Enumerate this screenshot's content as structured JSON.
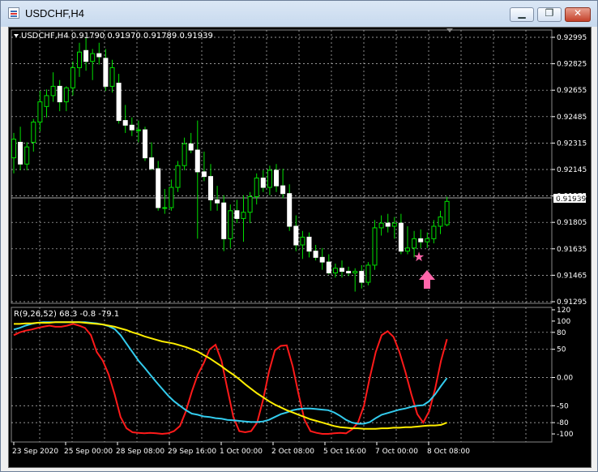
{
  "window": {
    "title": "USDCHF,H4",
    "minimize_glyph": "▁",
    "restore_glyph": "❐",
    "close_glyph": "✕"
  },
  "price_panel": {
    "header": "USDCHF,H4  0.91790 0.91970 0.91789 0.91939",
    "current_price": "0.91939",
    "price_ticks": [
      "0.92995",
      "0.92825",
      "0.92655",
      "0.92485",
      "0.92315",
      "0.92145",
      "0.91975",
      "0.91805",
      "0.91635",
      "0.91465",
      "0.91295"
    ]
  },
  "indicator_panel": {
    "header": "R(9,26,52) 68.3 -0.8 -79.1",
    "ticks": [
      "120",
      "100",
      "80",
      "50",
      "0.00",
      "-50",
      "-80",
      "-100"
    ]
  },
  "time_axis": {
    "labels": [
      "23 Sep 2020",
      "25 Sep 00:00",
      "28 Sep 08:00",
      "29 Sep 16:00",
      "1 Oct 00:00",
      "2 Oct 08:00",
      "5 Oct 16:00",
      "7 Oct 00:00",
      "8 Oct 08:00"
    ]
  },
  "annotations": {
    "star_color": "#ff66aa",
    "arrow_color": "#ff66aa"
  },
  "chart_data": [
    {
      "type": "candlestick",
      "title": "USDCHF,H4",
      "ylim": [
        0.91295,
        0.92995
      ],
      "candles": [
        {
          "o": 0.9222,
          "h": 0.9238,
          "l": 0.9212,
          "c": 0.9234
        },
        {
          "o": 0.9232,
          "h": 0.9242,
          "l": 0.9214,
          "c": 0.9218
        },
        {
          "o": 0.9218,
          "h": 0.9232,
          "l": 0.9214,
          "c": 0.9229
        },
        {
          "o": 0.9232,
          "h": 0.9247,
          "l": 0.9226,
          "c": 0.9245
        },
        {
          "o": 0.9245,
          "h": 0.9265,
          "l": 0.9239,
          "c": 0.9258
        },
        {
          "o": 0.9255,
          "h": 0.9266,
          "l": 0.9248,
          "c": 0.9262
        },
        {
          "o": 0.9262,
          "h": 0.9277,
          "l": 0.9258,
          "c": 0.9268
        },
        {
          "o": 0.9268,
          "h": 0.9272,
          "l": 0.9252,
          "c": 0.9258
        },
        {
          "o": 0.9258,
          "h": 0.9268,
          "l": 0.9252,
          "c": 0.9267
        },
        {
          "o": 0.9267,
          "h": 0.9284,
          "l": 0.9262,
          "c": 0.928
        },
        {
          "o": 0.928,
          "h": 0.9296,
          "l": 0.9274,
          "c": 0.929
        },
        {
          "o": 0.9291,
          "h": 0.9299,
          "l": 0.9278,
          "c": 0.9284
        },
        {
          "o": 0.9284,
          "h": 0.9292,
          "l": 0.9272,
          "c": 0.9289
        },
        {
          "o": 0.9289,
          "h": 0.9296,
          "l": 0.9282,
          "c": 0.9287
        },
        {
          "o": 0.9286,
          "h": 0.9292,
          "l": 0.9265,
          "c": 0.9268
        },
        {
          "o": 0.9268,
          "h": 0.9285,
          "l": 0.9264,
          "c": 0.928
        },
        {
          "o": 0.927,
          "h": 0.9276,
          "l": 0.9244,
          "c": 0.9246
        },
        {
          "o": 0.9246,
          "h": 0.9256,
          "l": 0.9238,
          "c": 0.9243
        },
        {
          "o": 0.9243,
          "h": 0.9248,
          "l": 0.9236,
          "c": 0.924
        },
        {
          "o": 0.924,
          "h": 0.9246,
          "l": 0.9232,
          "c": 0.924
        },
        {
          "o": 0.924,
          "h": 0.9242,
          "l": 0.922,
          "c": 0.9222
        },
        {
          "o": 0.9222,
          "h": 0.9232,
          "l": 0.9214,
          "c": 0.9215
        },
        {
          "o": 0.9215,
          "h": 0.922,
          "l": 0.9188,
          "c": 0.919
        },
        {
          "o": 0.919,
          "h": 0.9202,
          "l": 0.9186,
          "c": 0.919
        },
        {
          "o": 0.919,
          "h": 0.9208,
          "l": 0.9188,
          "c": 0.9203
        },
        {
          "o": 0.9203,
          "h": 0.922,
          "l": 0.92,
          "c": 0.9217
        },
        {
          "o": 0.9217,
          "h": 0.9235,
          "l": 0.9214,
          "c": 0.9231
        },
        {
          "o": 0.9231,
          "h": 0.9238,
          "l": 0.9225,
          "c": 0.9227
        },
        {
          "o": 0.9227,
          "h": 0.9246,
          "l": 0.917,
          "c": 0.9213
        },
        {
          "o": 0.9213,
          "h": 0.9226,
          "l": 0.9207,
          "c": 0.921
        },
        {
          "o": 0.921,
          "h": 0.9218,
          "l": 0.9188,
          "c": 0.9195
        },
        {
          "o": 0.9195,
          "h": 0.9204,
          "l": 0.9188,
          "c": 0.9193
        },
        {
          "o": 0.9193,
          "h": 0.9198,
          "l": 0.9162,
          "c": 0.917
        },
        {
          "o": 0.917,
          "h": 0.9192,
          "l": 0.9164,
          "c": 0.9188
        },
        {
          "o": 0.9188,
          "h": 0.9195,
          "l": 0.918,
          "c": 0.9183
        },
        {
          "o": 0.9183,
          "h": 0.9198,
          "l": 0.9168,
          "c": 0.9187
        },
        {
          "o": 0.9187,
          "h": 0.92,
          "l": 0.918,
          "c": 0.9197
        },
        {
          "o": 0.9197,
          "h": 0.9212,
          "l": 0.9192,
          "c": 0.9209
        },
        {
          "o": 0.9209,
          "h": 0.9214,
          "l": 0.92,
          "c": 0.9203
        },
        {
          "o": 0.9203,
          "h": 0.9217,
          "l": 0.9198,
          "c": 0.9214
        },
        {
          "o": 0.9214,
          "h": 0.9218,
          "l": 0.92,
          "c": 0.9204
        },
        {
          "o": 0.9204,
          "h": 0.9215,
          "l": 0.9196,
          "c": 0.9199
        },
        {
          "o": 0.9199,
          "h": 0.9205,
          "l": 0.9175,
          "c": 0.9178
        },
        {
          "o": 0.9178,
          "h": 0.9185,
          "l": 0.9162,
          "c": 0.9166
        },
        {
          "o": 0.9166,
          "h": 0.9175,
          "l": 0.9157,
          "c": 0.9171
        },
        {
          "o": 0.9171,
          "h": 0.9174,
          "l": 0.9158,
          "c": 0.9162
        },
        {
          "o": 0.9162,
          "h": 0.9166,
          "l": 0.9156,
          "c": 0.9158
        },
        {
          "o": 0.9158,
          "h": 0.9164,
          "l": 0.915,
          "c": 0.9155
        },
        {
          "o": 0.9155,
          "h": 0.916,
          "l": 0.9147,
          "c": 0.9148
        },
        {
          "o": 0.9148,
          "h": 0.9154,
          "l": 0.9145,
          "c": 0.9151
        },
        {
          "o": 0.9151,
          "h": 0.9156,
          "l": 0.9145,
          "c": 0.9149
        },
        {
          "o": 0.9149,
          "h": 0.9152,
          "l": 0.9146,
          "c": 0.9148
        },
        {
          "o": 0.9148,
          "h": 0.9151,
          "l": 0.9136,
          "c": 0.9149
        },
        {
          "o": 0.9149,
          "h": 0.9153,
          "l": 0.9138,
          "c": 0.9142
        },
        {
          "o": 0.9142,
          "h": 0.9155,
          "l": 0.914,
          "c": 0.9153
        },
        {
          "o": 0.9153,
          "h": 0.9182,
          "l": 0.915,
          "c": 0.9177
        },
        {
          "o": 0.9177,
          "h": 0.9185,
          "l": 0.9172,
          "c": 0.918
        },
        {
          "o": 0.918,
          "h": 0.9186,
          "l": 0.9174,
          "c": 0.9178
        },
        {
          "o": 0.9178,
          "h": 0.9184,
          "l": 0.917,
          "c": 0.918
        },
        {
          "o": 0.918,
          "h": 0.9186,
          "l": 0.916,
          "c": 0.9162
        },
        {
          "o": 0.9162,
          "h": 0.9178,
          "l": 0.916,
          "c": 0.9164
        },
        {
          "o": 0.9164,
          "h": 0.9175,
          "l": 0.9158,
          "c": 0.917
        },
        {
          "o": 0.917,
          "h": 0.9176,
          "l": 0.9164,
          "c": 0.9168
        },
        {
          "o": 0.9168,
          "h": 0.9174,
          "l": 0.9164,
          "c": 0.917
        },
        {
          "o": 0.917,
          "h": 0.9182,
          "l": 0.9167,
          "c": 0.9178
        },
        {
          "o": 0.9178,
          "h": 0.9188,
          "l": 0.9173,
          "c": 0.9184
        },
        {
          "o": 0.9179,
          "h": 0.9197,
          "l": 0.9178,
          "c": 0.9194
        }
      ]
    },
    {
      "type": "line",
      "title": "R(9,26,52)",
      "ylim": [
        -110,
        120
      ],
      "series": [
        {
          "color": "#ff1a1a",
          "values": [
            75,
            80,
            83,
            85,
            88,
            90,
            92,
            90,
            90,
            92,
            95,
            92,
            88,
            75,
            45,
            30,
            5,
            -30,
            -70,
            -90,
            -97,
            -98,
            -99,
            -98,
            -99,
            -100,
            -99,
            -95,
            -86,
            -60,
            -25,
            5,
            25,
            50,
            58,
            30,
            -20,
            -70,
            -95,
            -97,
            -95,
            -80,
            -40,
            10,
            48,
            56,
            57,
            20,
            -30,
            -75,
            -95,
            -98,
            -100,
            -100,
            -99,
            -98,
            -99,
            -92,
            -80,
            -50,
            0,
            45,
            75,
            82,
            72,
            45,
            10,
            -30,
            -65,
            -80,
            -60,
            -20,
            30,
            68
          ]
        },
        {
          "color": "#33ccee",
          "values": [
            85,
            88,
            92,
            95,
            97,
            98,
            98,
            98,
            98,
            98,
            98,
            98,
            98,
            97,
            96,
            94,
            91,
            86,
            75,
            60,
            45,
            30,
            18,
            5,
            -8,
            -20,
            -32,
            -42,
            -50,
            -58,
            -64,
            -66,
            -69,
            -70,
            -72,
            -73,
            -75,
            -76,
            -77,
            -78,
            -79,
            -79,
            -78,
            -75,
            -70,
            -65,
            -62,
            -58,
            -56,
            -55,
            -55,
            -56,
            -57,
            -58,
            -62,
            -68,
            -75,
            -80,
            -82,
            -82,
            -79,
            -72,
            -66,
            -63,
            -60,
            -57,
            -55,
            -52,
            -50,
            -49,
            -42,
            -30,
            -15,
            -1
          ]
        },
        {
          "color": "#ffee00",
          "values": [
            95,
            95,
            96,
            96,
            97,
            97,
            97,
            98,
            98,
            98,
            98,
            98,
            97,
            96,
            95,
            94,
            92,
            90,
            87,
            84,
            80,
            77,
            73,
            70,
            67,
            64,
            62,
            60,
            57,
            54,
            50,
            46,
            40,
            34,
            27,
            20,
            12,
            5,
            -3,
            -12,
            -20,
            -28,
            -35,
            -42,
            -48,
            -53,
            -58,
            -62,
            -66,
            -70,
            -74,
            -77,
            -80,
            -83,
            -86,
            -88,
            -89,
            -90,
            -90,
            -91,
            -91,
            -91,
            -90,
            -90,
            -89,
            -89,
            -88,
            -88,
            -87,
            -86,
            -85,
            -85,
            -84,
            -80
          ]
        }
      ]
    }
  ]
}
